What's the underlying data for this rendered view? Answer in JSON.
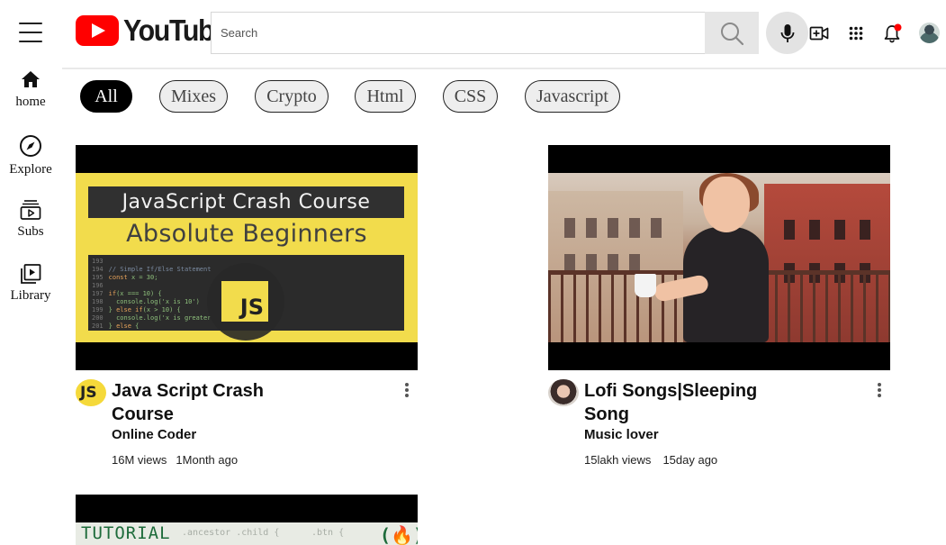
{
  "header": {
    "logo_text": "YouTube",
    "search_placeholder": "Search"
  },
  "sidebar": {
    "items": [
      {
        "label": "home",
        "icon": "home-icon"
      },
      {
        "label": "Explore",
        "icon": "compass-icon"
      },
      {
        "label": "Subs",
        "icon": "subscriptions-icon"
      },
      {
        "label": "Library",
        "icon": "library-icon"
      }
    ]
  },
  "chips": [
    {
      "label": "All",
      "active": true
    },
    {
      "label": "Mixes",
      "active": false
    },
    {
      "label": "Crypto",
      "active": false
    },
    {
      "label": "Html",
      "active": false
    },
    {
      "label": "CSS",
      "active": false
    },
    {
      "label": "Javascript",
      "active": false
    }
  ],
  "videos": [
    {
      "title": "Java Script Crash Course",
      "channel": "Online Coder",
      "views": "16M views",
      "age": "1Month ago",
      "thumb_heading": "JavaScript Crash Course",
      "thumb_subheading": "Absolute Beginners",
      "thumb_badge": "JS",
      "avatar_text": "JS"
    },
    {
      "title": "Lofi Songs|Sleeping Song",
      "channel": "Music lover",
      "views": "15lakh views",
      "age": "15day ago"
    },
    {
      "thumb_heading": "TUTORIAL"
    }
  ],
  "colors": {
    "brand_red": "#ff0000",
    "chip_active_bg": "#000000",
    "chip_bg": "#eeeeee",
    "notification_dot": "#ff0000"
  }
}
